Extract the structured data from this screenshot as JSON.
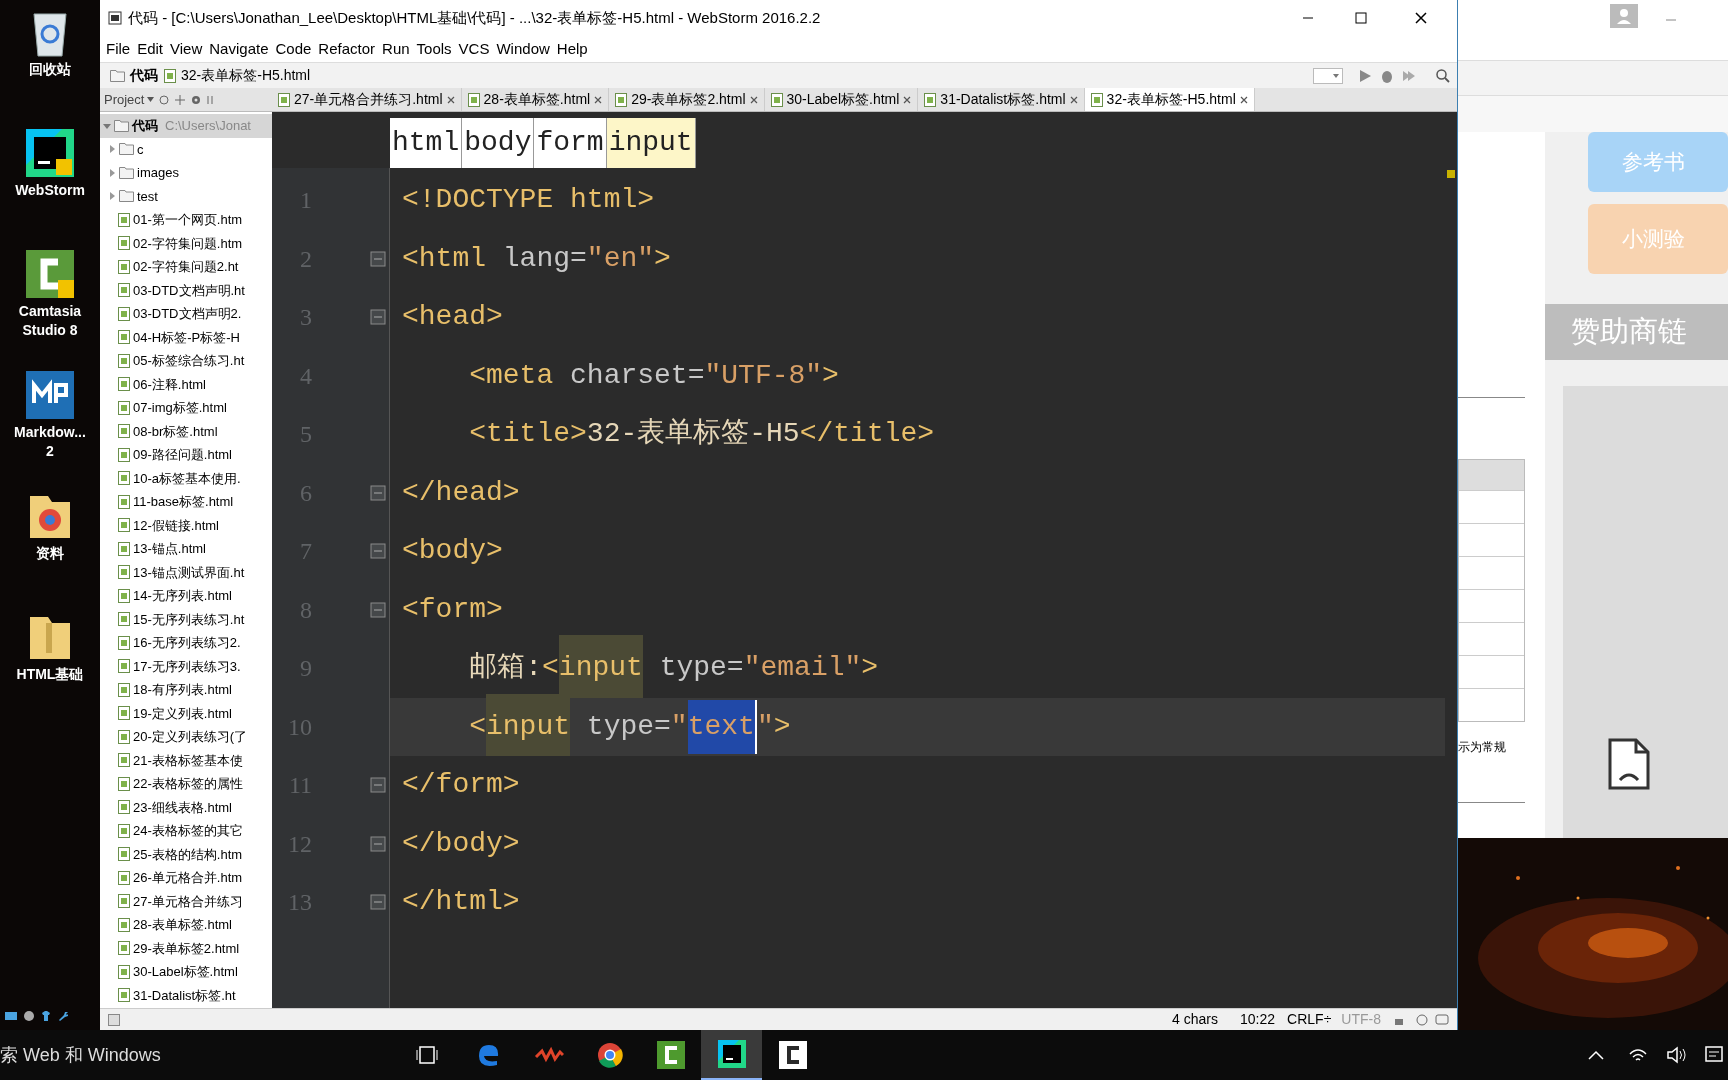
{
  "desktop": {
    "icons": [
      {
        "kind": "recycle",
        "label": "回收站"
      },
      {
        "kind": "webstorm",
        "label": "WebStorm"
      },
      {
        "kind": "camtasia",
        "label": "Camtasia Studio 8"
      },
      {
        "kind": "markdown",
        "label": "Markdow...\n2"
      },
      {
        "kind": "folder-chrome",
        "label": "资料"
      },
      {
        "kind": "folder",
        "label": "HTML基础"
      }
    ]
  },
  "window": {
    "title": "代码 - [C:\\Users\\Jonathan_Lee\\Desktop\\HTML基础\\代码] - ...\\32-表单标签-H5.html - WebStorm 2016.2.2"
  },
  "menu": [
    "File",
    "Edit",
    "View",
    "Navigate",
    "Code",
    "Refactor",
    "Run",
    "Tools",
    "VCS",
    "Window",
    "Help"
  ],
  "navbar": {
    "crumbs": [
      {
        "kind": "folder",
        "label": "代码"
      },
      {
        "kind": "file",
        "label": "32-表单标签-H5.html"
      }
    ]
  },
  "project_panel": {
    "label": "Project",
    "root": {
      "label": "代码",
      "path": "C:\\Users\\Jonat",
      "expanded": true,
      "selected": true,
      "children": [
        {
          "kind": "folder",
          "label": "c",
          "expanded": false
        },
        {
          "kind": "folder",
          "label": "images",
          "expanded": false
        },
        {
          "kind": "folder",
          "label": "test",
          "expanded": false
        },
        {
          "kind": "file",
          "label": "01-第一个网页.htm"
        },
        {
          "kind": "file",
          "label": "02-字符集问题.htm"
        },
        {
          "kind": "file",
          "label": "02-字符集问题2.ht"
        },
        {
          "kind": "file",
          "label": "03-DTD文档声明.ht"
        },
        {
          "kind": "file",
          "label": "03-DTD文档声明2."
        },
        {
          "kind": "file",
          "label": "04-H标签-P标签-H"
        },
        {
          "kind": "file",
          "label": "05-标签综合练习.ht"
        },
        {
          "kind": "file",
          "label": "06-注释.html"
        },
        {
          "kind": "file",
          "label": "07-img标签.html"
        },
        {
          "kind": "file",
          "label": "08-br标签.html"
        },
        {
          "kind": "file",
          "label": "09-路径问题.html"
        },
        {
          "kind": "file",
          "label": "10-a标签基本使用."
        },
        {
          "kind": "file",
          "label": "11-base标签.html"
        },
        {
          "kind": "file",
          "label": "12-假链接.html"
        },
        {
          "kind": "file",
          "label": "13-锚点.html"
        },
        {
          "kind": "file",
          "label": "13-锚点测试界面.ht"
        },
        {
          "kind": "file",
          "label": "14-无序列表.html"
        },
        {
          "kind": "file",
          "label": "15-无序列表练习.ht"
        },
        {
          "kind": "file",
          "label": "16-无序列表练习2."
        },
        {
          "kind": "file",
          "label": "17-无序列表练习3."
        },
        {
          "kind": "file",
          "label": "18-有序列表.html"
        },
        {
          "kind": "file",
          "label": "19-定义列表.html"
        },
        {
          "kind": "file",
          "label": "20-定义列表练习(了"
        },
        {
          "kind": "file",
          "label": "21-表格标签基本使"
        },
        {
          "kind": "file",
          "label": "22-表格标签的属性"
        },
        {
          "kind": "file",
          "label": "23-细线表格.html"
        },
        {
          "kind": "file",
          "label": "24-表格标签的其它"
        },
        {
          "kind": "file",
          "label": "25-表格的结构.htm"
        },
        {
          "kind": "file",
          "label": "26-单元格合并.htm"
        },
        {
          "kind": "file",
          "label": "27-单元格合并练习"
        },
        {
          "kind": "file",
          "label": "28-表单标签.html"
        },
        {
          "kind": "file",
          "label": "29-表单标签2.html"
        },
        {
          "kind": "file",
          "label": "30-Label标签.html"
        },
        {
          "kind": "file",
          "label": "31-Datalist标签.ht"
        }
      ]
    }
  },
  "tabs": [
    {
      "label": "27-单元格合并练习.html",
      "selected": false
    },
    {
      "label": "28-表单标签.html",
      "selected": false
    },
    {
      "label": "29-表单标签2.html",
      "selected": false
    },
    {
      "label": "30-Label标签.html",
      "selected": false
    },
    {
      "label": "31-Datalist标签.html",
      "selected": false
    },
    {
      "label": "32-表单标签-H5.html",
      "selected": true
    }
  ],
  "editor": {
    "breadcrumbs": [
      {
        "label": "html",
        "selected": false
      },
      {
        "label": "body",
        "selected": false
      },
      {
        "label": "form",
        "selected": false
      },
      {
        "label": "input",
        "selected": true
      }
    ],
    "lines": [
      {
        "number": "1",
        "fold": false,
        "current": false,
        "tokens": [
          {
            "kind": "tag",
            "text": "<!DOCTYPE html>"
          }
        ]
      },
      {
        "number": "2",
        "fold": true,
        "current": false,
        "tokens": [
          {
            "kind": "tag",
            "text": "<html"
          },
          {
            "kind": "attr",
            "text": " lang="
          },
          {
            "kind": "value",
            "text": "\"en\""
          },
          {
            "kind": "tag",
            "text": ">"
          }
        ]
      },
      {
        "number": "3",
        "fold": true,
        "current": false,
        "tokens": [
          {
            "kind": "tag",
            "text": "<head>"
          }
        ]
      },
      {
        "number": "4",
        "fold": false,
        "current": false,
        "tokens": [
          {
            "kind": "tag",
            "text": "    <meta"
          },
          {
            "kind": "attr",
            "text": " charset="
          },
          {
            "kind": "value",
            "text": "\"UTF-8\""
          },
          {
            "kind": "tag",
            "text": ">"
          }
        ]
      },
      {
        "number": "5",
        "fold": false,
        "current": false,
        "tokens": [
          {
            "kind": "tag",
            "text": "    <title>"
          },
          {
            "kind": "text",
            "text": "32-表单标签-H5"
          },
          {
            "kind": "tag",
            "text": "</title>"
          }
        ]
      },
      {
        "number": "6",
        "fold": true,
        "current": false,
        "tokens": [
          {
            "kind": "tag",
            "text": "</head>"
          }
        ]
      },
      {
        "number": "7",
        "fold": true,
        "current": false,
        "tokens": [
          {
            "kind": "tag",
            "text": "<body>"
          }
        ]
      },
      {
        "number": "8",
        "fold": true,
        "current": false,
        "tokens": [
          {
            "kind": "tag",
            "text": "<form>"
          }
        ]
      },
      {
        "number": "9",
        "fold": false,
        "current": false,
        "tokens": [
          {
            "kind": "text",
            "text": "    邮箱:"
          },
          {
            "kind": "tag",
            "text": "<"
          },
          {
            "kind": "tag",
            "text": "input",
            "highlight": true
          },
          {
            "kind": "attr",
            "text": " type="
          },
          {
            "kind": "value",
            "text": "\"email\""
          },
          {
            "kind": "tag",
            "text": ">"
          }
        ]
      },
      {
        "number": "10",
        "fold": false,
        "current": true,
        "tokens": [
          {
            "kind": "tag",
            "text": "    <"
          },
          {
            "kind": "tag",
            "text": "input",
            "highlight": true
          },
          {
            "kind": "attr",
            "text": " type="
          },
          {
            "kind": "value",
            "text": "\""
          },
          {
            "kind": "value",
            "text": "text",
            "selected": true
          },
          {
            "kind": "value",
            "text": "\""
          },
          {
            "kind": "tag",
            "text": ">"
          }
        ]
      },
      {
        "number": "11",
        "fold": true,
        "current": false,
        "tokens": [
          {
            "kind": "tag",
            "text": "</form>"
          }
        ]
      },
      {
        "number": "12",
        "fold": true,
        "current": false,
        "tokens": [
          {
            "kind": "tag",
            "text": "</body>"
          }
        ]
      },
      {
        "number": "13",
        "fold": true,
        "current": false,
        "tokens": [
          {
            "kind": "tag",
            "text": "</html>"
          }
        ]
      }
    ]
  },
  "status_bar": {
    "selection": "4 chars",
    "position": "10:22",
    "line_separator": "CRLF÷",
    "encoding": "UTF-8"
  },
  "browser": {
    "buttons": [
      {
        "label": "参考书",
        "color": "#a8d4f7"
      },
      {
        "label": "小测验",
        "color": "#f8d3b0"
      }
    ],
    "sponsor_header": "赞助商链",
    "note": "示为常规"
  },
  "taskbar": {
    "search": "索 Web 和 Windows",
    "apps": [
      {
        "kind": "taskview",
        "active": false
      },
      {
        "kind": "edge",
        "active": false
      },
      {
        "kind": "red",
        "active": false
      },
      {
        "kind": "chrome",
        "active": false
      },
      {
        "kind": "camtasia",
        "active": false
      },
      {
        "kind": "webstorm",
        "active": true
      },
      {
        "kind": "camtasia2",
        "active": false
      }
    ]
  }
}
